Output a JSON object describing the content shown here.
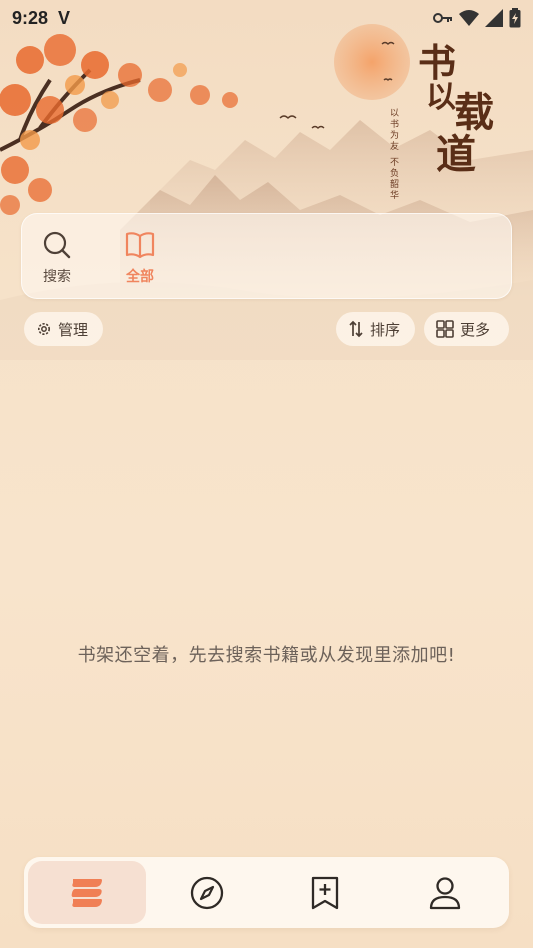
{
  "status_bar": {
    "time": "9:28",
    "carrier": "V",
    "icons": [
      "key-icon",
      "wifi-icon",
      "signal-icon",
      "battery-icon"
    ]
  },
  "banner": {
    "title_chars": [
      "书",
      "以",
      "载",
      "道"
    ],
    "subtitle": "以书为友 不负韶华"
  },
  "top_panel": {
    "tabs": [
      {
        "id": "search",
        "label": "搜索",
        "icon": "search-icon",
        "active": false
      },
      {
        "id": "all",
        "label": "全部",
        "icon": "open-book-icon",
        "active": true
      }
    ]
  },
  "toolbar": {
    "manage_label": "管理",
    "sort_label": "排序",
    "more_label": "更多"
  },
  "empty_message": "书架还空着，先去搜索书籍或从发现里添加吧!",
  "bottom_nav": [
    {
      "id": "bookshelf",
      "icon": "bookshelf-icon",
      "active": true
    },
    {
      "id": "discover",
      "icon": "compass-icon",
      "active": false
    },
    {
      "id": "bookmark",
      "icon": "bookmark-add-icon",
      "active": false
    },
    {
      "id": "profile",
      "icon": "person-icon",
      "active": false
    }
  ],
  "colors": {
    "accent": "#f0855e",
    "background": "#f6e2c9",
    "text": "#5a4a3e",
    "calligraphy": "#5a2e17"
  }
}
